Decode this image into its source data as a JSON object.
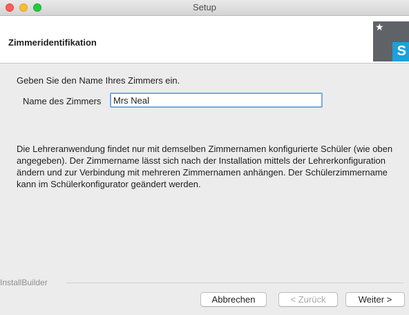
{
  "window": {
    "title": "Setup"
  },
  "header": {
    "title": "Zimmeridentifikation"
  },
  "main": {
    "intro": "Geben Sie den Name Ihres Zimmers ein.",
    "room_label": "Name des Zimmers",
    "room_value": "Mrs Neal",
    "info": "Die Lehreranwendung findet nur mit demselben Zimmernamen konfigurierte Schüler (wie oben angegeben). Der Zimmername lässt sich nach der Installation mittels der Lehrerkonfiguration ändern und zur Verbindung mit mehreren Zimmernamen anhängen. Der Schülerzimmername kann im Schülerkonfigurator geändert werden."
  },
  "footer": {
    "brand": "InstallBuilder",
    "cancel_label": "Abbrechen",
    "back_label": "< Zurück",
    "next_label": "Weiter >"
  },
  "logo": {
    "letter": "S",
    "icon": "star-icon"
  },
  "colors": {
    "accent": "#1ba1db",
    "focus": "#7aa7e8",
    "logo_bg": "#5f6368"
  }
}
